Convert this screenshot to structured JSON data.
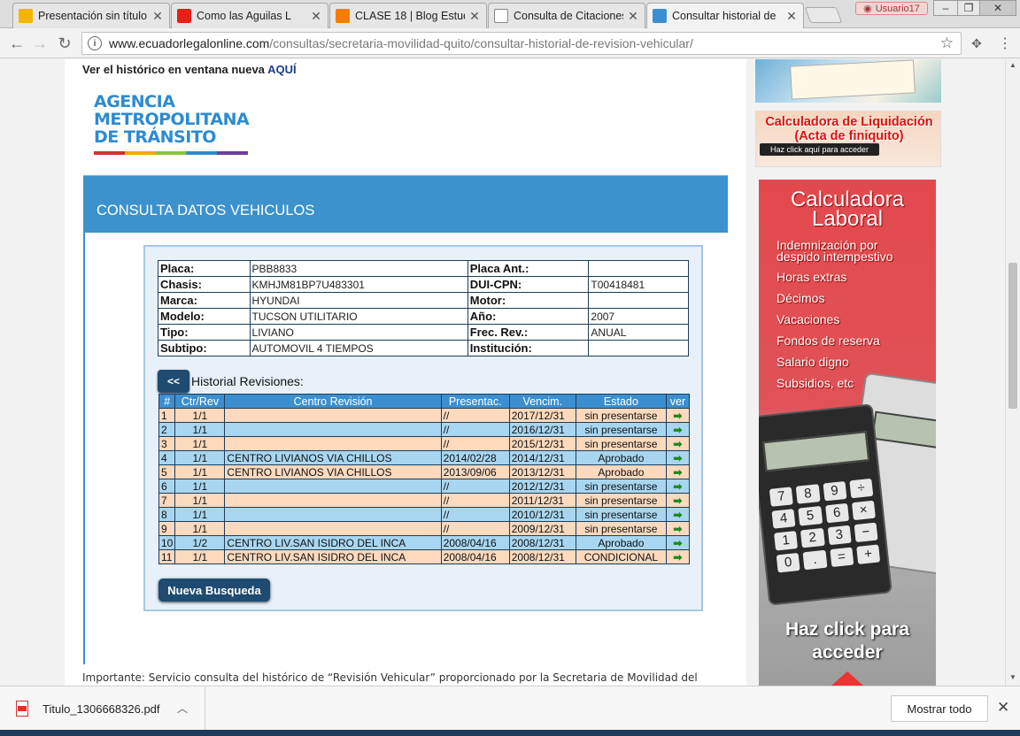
{
  "browser": {
    "tabs": [
      {
        "label": "Presentación sin título",
        "icon": "slides-icon",
        "color": "#f4b400"
      },
      {
        "label": "Como las Aguilas L",
        "icon": "youtube-icon",
        "color": "#e62117"
      },
      {
        "label": "CLASE 18 | Blog Estud",
        "icon": "blogger-icon",
        "color": "#f57d00"
      },
      {
        "label": "Consulta de Citaciones",
        "icon": "document-icon",
        "color": "#888888"
      },
      {
        "label": "Consultar historial de",
        "icon": "chart-icon",
        "color": "#3b8fd0"
      }
    ],
    "user": "Usuario17",
    "url_host": "www.ecuadorlegalonline.com",
    "url_path": "/consultas/secretaria-movilidad-quito/consultar-historial-de-revision-vehicular/"
  },
  "page": {
    "history_link_text": "Ver el histórico en ventana nueva",
    "history_link_anchor": "AQUÍ",
    "logo_lines": [
      "AGENCIA",
      "METROPOLITANA",
      "DE TRÁNSITO"
    ],
    "panel_title": "CONSULTA DATOS VEHICULOS",
    "vehicle": {
      "placa_label": "Placa:",
      "placa": "PBB8833",
      "placa_ant_label": "Placa Ant.:",
      "placa_ant": "",
      "chasis_label": "Chasis:",
      "chasis": "KMHJM81BP7U483301",
      "dui_label": "DUI-CPN:",
      "dui": "T00418481",
      "marca_label": "Marca:",
      "marca": "HYUNDAI",
      "motor_label": "Motor:",
      "motor": "",
      "modelo_label": "Modelo:",
      "modelo": "TUCSON UTILITARIO",
      "anio_label": "Año:",
      "anio": "2007",
      "tipo_label": "Tipo:",
      "tipo": "LIVIANO",
      "frec_label": "Frec. Rev.:",
      "frec": "ANUAL",
      "subtipo_label": "Subtipo:",
      "subtipo": "AUTOMOVIL 4 TIEMPOS",
      "institucion_label": "Institución:",
      "institucion": ""
    },
    "back_button": "<<",
    "history_title": "Historial Revisiones:",
    "history_headers": [
      "#",
      "Ctr/Rev",
      "Centro Revisión",
      "Presentac.",
      "Vencim.",
      "Estado",
      "ver"
    ],
    "history_rows": [
      [
        "1",
        "1/1",
        "",
        "//",
        "2017/12/31",
        "sin presentarse"
      ],
      [
        "2",
        "1/1",
        "",
        "//",
        "2016/12/31",
        "sin presentarse"
      ],
      [
        "3",
        "1/1",
        "",
        "//",
        "2015/12/31",
        "sin presentarse"
      ],
      [
        "4",
        "1/1",
        "CENTRO LIVIANOS VIA CHILLOS",
        "2014/02/28",
        "2014/12/31",
        "Aprobado"
      ],
      [
        "5",
        "1/1",
        "CENTRO LIVIANOS VIA CHILLOS",
        "2013/09/06",
        "2013/12/31",
        "Aprobado"
      ],
      [
        "6",
        "1/1",
        "",
        "//",
        "2012/12/31",
        "sin presentarse"
      ],
      [
        "7",
        "1/1",
        "",
        "//",
        "2011/12/31",
        "sin presentarse"
      ],
      [
        "8",
        "1/1",
        "",
        "//",
        "2010/12/31",
        "sin presentarse"
      ],
      [
        "9",
        "1/1",
        "",
        "//",
        "2009/12/31",
        "sin presentarse"
      ],
      [
        "10",
        "1/2",
        "CENTRO LIV.SAN ISIDRO DEL INCA",
        "2008/04/16",
        "2008/12/31",
        "Aprobado"
      ],
      [
        "11",
        "1/1",
        "CENTRO LIV.SAN ISIDRO DEL INCA",
        "2008/04/16",
        "2008/12/31",
        "CONDICIONAL"
      ]
    ],
    "new_search_button": "Nueva Busqueda",
    "footnote": "Importante: Servicio consulta del histórico de “Revisión Vehicular” proporcionado por la Secretaria de Movilidad del"
  },
  "ads": {
    "ad2_title": "Calculadora de Liquidación (Acta de finiquito)",
    "ad2_cta": "Haz click aquí para acceder",
    "ad3_title": "Calculadora Laboral",
    "ad3_items": [
      "Indemnización por despido intempestivo",
      "Horas extras",
      "Décimos",
      "Vacaciones",
      "Fondos de reserva",
      "Salario digno",
      "Subsidios, etc"
    ],
    "ad3_cta": "Haz click para acceder"
  },
  "downloads": {
    "file": "Titulo_1306668326.pdf",
    "show_all": "Mostrar todo"
  }
}
